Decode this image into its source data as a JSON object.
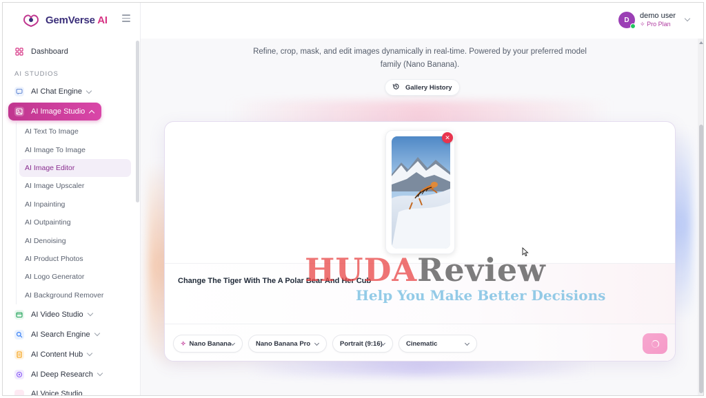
{
  "app": {
    "logo_prefix": "GemVerse",
    "logo_suffix": "AI"
  },
  "sidebar": {
    "dashboard_label": "Dashboard",
    "section_label": "AI STUDIOS",
    "items": [
      {
        "label": "AI Chat Engine",
        "icon": "chat-icon",
        "color": "#6b8fd6"
      },
      {
        "label": "AI Image Studio",
        "icon": "image-icon",
        "color": "#ffffff"
      },
      {
        "label": "AI Video Studio",
        "icon": "video-icon",
        "color": "#22a35a"
      },
      {
        "label": "AI Search Engine",
        "icon": "search-icon",
        "color": "#3b82f6"
      },
      {
        "label": "AI Content Hub",
        "icon": "document-icon",
        "color": "#f59e0b"
      },
      {
        "label": "AI Deep Research",
        "icon": "research-icon",
        "color": "#8b5cf6"
      },
      {
        "label": "AI Voice Studio",
        "icon": "voice-icon",
        "color": "#ec4899"
      }
    ],
    "image_studio_sub": [
      "AI Text To Image",
      "AI Image To Image",
      "AI Image Editor",
      "AI Image Upscaler",
      "AI Inpainting",
      "AI Outpainting",
      "AI Denoising",
      "AI Product Photos",
      "AI Logo Generator",
      "AI Background Remover"
    ],
    "active_sub": "AI Image Editor"
  },
  "header": {
    "user_name": "demo user",
    "user_plan": "Pro Plan",
    "avatar_initial": "D"
  },
  "main": {
    "subtitle": "Refine, crop, mask, and edit images dynamically in real-time. Powered by your preferred model family (Nano Banana).",
    "gallery_button": "Gallery History",
    "prompt": "Change The Tiger With The A Polar Bear And Her Cub",
    "model_family": "Nano Banana",
    "model": "Nano Banana Pro",
    "aspect_ratio": "Portrait (9:16)",
    "style": "Cinematic"
  },
  "watermark": {
    "brand_red": "HUDA",
    "brand_dark": "Review",
    "tagline": "Help You Make Better Decisions"
  },
  "colors": {
    "accent": "#c0368f",
    "active_sub_bg": "#f3eef8",
    "generate_button": "#f7a7cf",
    "close_badge": "#e8344e"
  }
}
